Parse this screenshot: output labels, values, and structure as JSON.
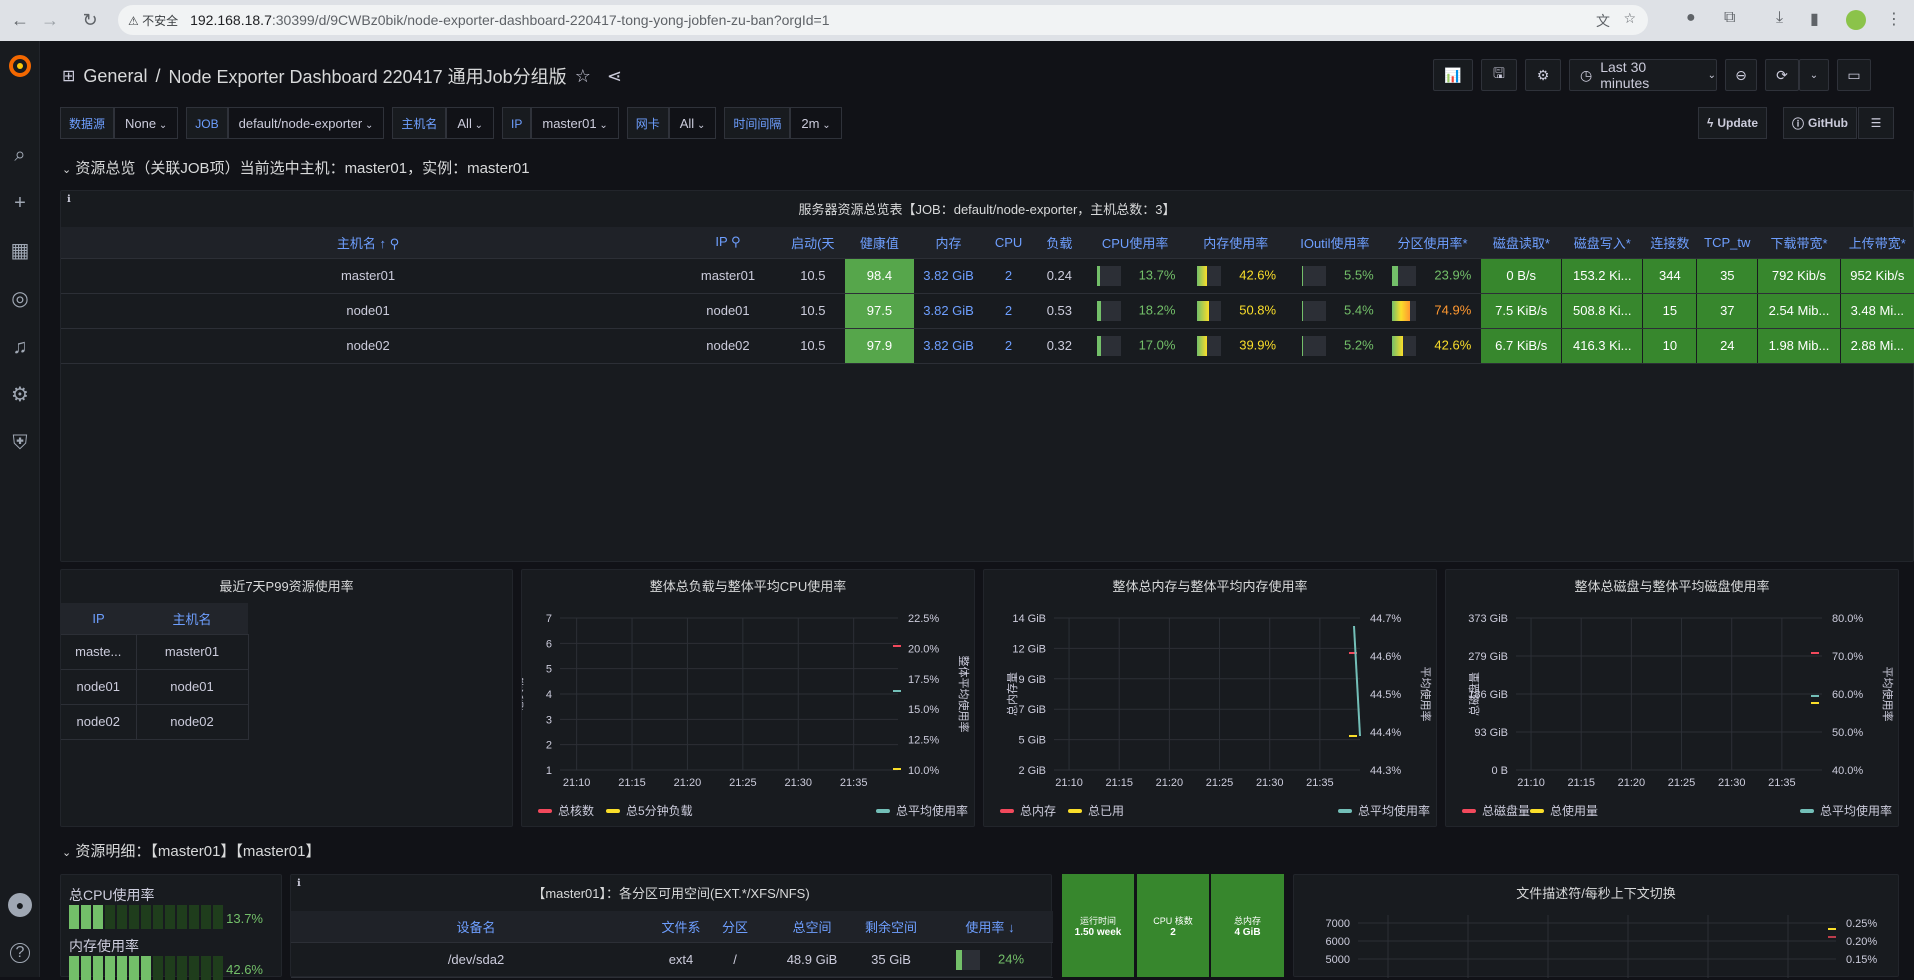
{
  "browser": {
    "security": "不安全",
    "url_host": "192.168.18.7",
    "url_path": ":30399/d/9CWBz0bik/node-exporter-dashboard-220417-tong-yong-jobfen-zu-ban?orgId=1"
  },
  "header": {
    "crumb_root": "General",
    "crumb_sep": "/",
    "dashboard_title": "Node Exporter Dashboard 220417 通用Job分组版",
    "time_range": "Last 30 minutes"
  },
  "variables": [
    {
      "label": "数据源",
      "value": "None"
    },
    {
      "label": "JOB",
      "value": "default/node-exporter"
    },
    {
      "label": "主机名",
      "value": "All"
    },
    {
      "label": "IP",
      "value": "master01"
    },
    {
      "label": "网卡",
      "value": "All"
    },
    {
      "label": "时间间隔",
      "value": "2m"
    }
  ],
  "links": {
    "update": "Update",
    "github": "GitHub"
  },
  "row1": {
    "title": "资源总览（关联JOB项）当前选中主机：master01，实例：master01"
  },
  "overview": {
    "title": "服务器资源总览表【JOB：default/node-exporter，主机总数：3】",
    "columns": [
      "主机名",
      "IP",
      "启动(天",
      "健康值",
      "内存",
      "CPU",
      "负载",
      "CPU使用率",
      "内存使用率",
      "IOutil使用率",
      "分区使用率*",
      "磁盘读取*",
      "磁盘写入*",
      "连接数",
      "TCP_tw",
      "下载带宽*",
      "上传带宽*"
    ],
    "rows": [
      {
        "host": "master01",
        "ip": "master01",
        "uptime": "10.5",
        "health": "98.4",
        "mem": "3.82 GiB",
        "cpu": "2",
        "load": "0.24",
        "cpu_pct": "13.7%",
        "cpu_frac": 0.137,
        "mem_pct": "42.6%",
        "mem_frac": 0.426,
        "io_pct": "5.5%",
        "io_frac": 0.055,
        "part_pct": "23.9%",
        "part_frac": 0.239,
        "disk_r": "0 B/s",
        "disk_w": "153.2 Ki...",
        "conn": "344",
        "tcp_tw": "35",
        "down": "792 Kib/s",
        "up": "952 Kib/s"
      },
      {
        "host": "node01",
        "ip": "node01",
        "uptime": "10.5",
        "health": "97.5",
        "mem": "3.82 GiB",
        "cpu": "2",
        "load": "0.53",
        "cpu_pct": "18.2%",
        "cpu_frac": 0.182,
        "mem_pct": "50.8%",
        "mem_frac": 0.508,
        "io_pct": "5.4%",
        "io_frac": 0.054,
        "part_pct": "74.9%",
        "part_frac": 0.749,
        "disk_r": "7.5 KiB/s",
        "disk_w": "508.8 Ki...",
        "conn": "15",
        "tcp_tw": "37",
        "down": "2.54 Mib...",
        "up": "3.48 Mi..."
      },
      {
        "host": "node02",
        "ip": "node02",
        "uptime": "10.5",
        "health": "97.9",
        "mem": "3.82 GiB",
        "cpu": "2",
        "load": "0.32",
        "cpu_pct": "17.0%",
        "cpu_frac": 0.17,
        "mem_pct": "39.9%",
        "mem_frac": 0.399,
        "io_pct": "5.2%",
        "io_frac": 0.052,
        "part_pct": "42.6%",
        "part_frac": 0.426,
        "disk_r": "6.7 KiB/s",
        "disk_w": "416.3 Ki...",
        "conn": "10",
        "tcp_tw": "24",
        "down": "1.98 Mib...",
        "up": "2.88 Mi..."
      }
    ]
  },
  "p99": {
    "title": "最近7天P99资源使用率",
    "columns": [
      "IP",
      "主机名"
    ],
    "rows": [
      [
        "maste...",
        "master01"
      ],
      [
        "node01",
        "node01"
      ],
      [
        "node02",
        "node02"
      ]
    ]
  },
  "chart_data": [
    {
      "type": "line",
      "title": "整体总负载与整体平均CPU使用率",
      "ylabel": "总负载",
      "y2label": "整体平均使用率",
      "x": [
        "21:10",
        "21:15",
        "21:20",
        "21:25",
        "21:30",
        "21:35"
      ],
      "yticks": [
        "1",
        "2",
        "3",
        "4",
        "5",
        "6",
        "7"
      ],
      "y2ticks": [
        "10.0%",
        "12.5%",
        "15.0%",
        "17.5%",
        "20.0%",
        "22.5%"
      ],
      "series": [
        {
          "name": "总核数",
          "color": "#f2495c",
          "values": [
            6
          ]
        },
        {
          "name": "总5分钟负载",
          "color": "#fade2a",
          "values": [
            1.09
          ]
        },
        {
          "name": "总平均使用率",
          "color": "#73bfb8",
          "values": [
            16.3
          ]
        }
      ]
    },
    {
      "type": "line",
      "title": "整体总内存与整体平均内存使用率",
      "ylabel": "总内存量",
      "y2label": "平均使用率",
      "x": [
        "21:10",
        "21:15",
        "21:20",
        "21:25",
        "21:30",
        "21:35"
      ],
      "yticks": [
        "2 GiB",
        "5 GiB",
        "7 GiB",
        "9 GiB",
        "12 GiB",
        "14 GiB"
      ],
      "y2ticks": [
        "44.3%",
        "44.4%",
        "44.5%",
        "44.6%",
        "44.7%"
      ],
      "series": [
        {
          "name": "总内存",
          "color": "#f2495c",
          "values": [
            "11.5 GiB"
          ]
        },
        {
          "name": "总已用",
          "color": "#fade2a",
          "values": [
            "5 GiB"
          ]
        },
        {
          "name": "总平均使用率",
          "color": "#73bfb8",
          "values": [
            "44.68%",
            "44.4%"
          ]
        }
      ]
    },
    {
      "type": "line",
      "title": "整体总磁盘与整体平均磁盘使用率",
      "ylabel": "总磁盘量",
      "y2label": "平均使用率",
      "x": [
        "21:10",
        "21:15",
        "21:20",
        "21:25",
        "21:30",
        "21:35"
      ],
      "yticks": [
        "0 B",
        "93 GiB",
        "186 GiB",
        "279 GiB",
        "373 GiB"
      ],
      "y2ticks": [
        "40.0%",
        "50.0%",
        "60.0%",
        "70.0%",
        "80.0%"
      ],
      "series": [
        {
          "name": "总磁盘量",
          "color": "#f2495c",
          "values": [
            "291 GiB"
          ]
        },
        {
          "name": "总使用量",
          "color": "#fade2a",
          "values": [
            "160 GiB"
          ]
        },
        {
          "name": "总平均使用率",
          "color": "#73bfb8",
          "values": [
            "59%"
          ]
        }
      ]
    },
    {
      "type": "line",
      "title": "文件描述符/每秒上下文切换",
      "yticks": [
        "7000",
        "6000",
        "5000"
      ],
      "y2ticks": [
        "0.25%",
        "0.20%",
        "0.15%"
      ],
      "series": []
    }
  ],
  "row2": {
    "title": "资源明细：【master01】【master01】"
  },
  "cpu_gauge": {
    "label1": "总CPU使用率",
    "val1": "13.7%",
    "frac1": 0.137,
    "label2": "内存使用率",
    "val2": "42.6%",
    "frac2": 0.426
  },
  "partition": {
    "title": "【master01】：各分区可用空间(EXT.*/XFS/NFS)",
    "columns": [
      "设备名",
      "文件系",
      "分区",
      "总空间",
      "剩余空间",
      "使用率"
    ],
    "row": {
      "dev": "/dev/sda2",
      "fs": "ext4",
      "mount": "/",
      "total": "48.9 GiB",
      "free": "35 GiB",
      "pct": "24%",
      "frac": 0.24
    }
  },
  "stats": [
    {
      "title": "运行时间",
      "value": "1.50 week"
    },
    {
      "title": "CPU 核数",
      "value": "2"
    },
    {
      "title": "总内存",
      "value": "4 GiB"
    }
  ]
}
